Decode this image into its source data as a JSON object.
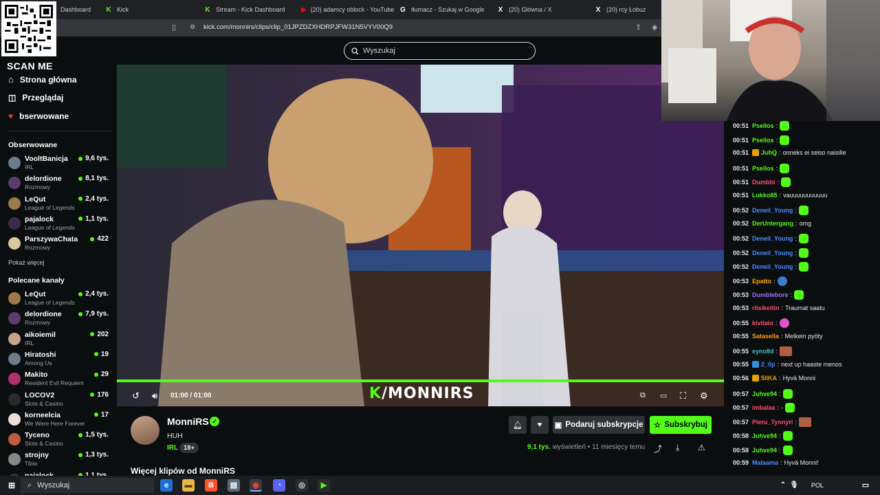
{
  "browser": {
    "tabs": [
      {
        "label": "Dashboard",
        "icon": "kick-icon",
        "color": "#53fc18"
      },
      {
        "label": "Kick",
        "icon": "kick-icon",
        "color": "#53fc18"
      },
      {
        "label": "Stream - Kick Dashboard",
        "icon": "kick-icon",
        "color": "#53fc18"
      },
      {
        "label": "(20) adamcy oblock - YouTube",
        "icon": "youtube-icon",
        "color": "#ff0000"
      },
      {
        "label": "tłumacz - Szukaj w Google",
        "icon": "google-icon",
        "color": "#ffffff"
      },
      {
        "label": "(20) Główna / X",
        "icon": "x-icon",
        "color": "#ffffff"
      },
      {
        "label": "(20) rcy Łobuz",
        "icon": "x-icon",
        "color": "#ffffff"
      }
    ],
    "url": "kick.com/monnirs/clips/clip_01JPZDZXHDRPJFW31N5VYV00Q9"
  },
  "overlay": {
    "scan_me": "SCAN ME"
  },
  "search": {
    "placeholder": "Wyszukaj"
  },
  "sidebar": {
    "nav": [
      {
        "label": "Strona główna",
        "icon": "home-icon"
      },
      {
        "label": "Przeglądaj",
        "icon": "browse-icon"
      },
      {
        "label": "bserwowane",
        "icon": "heart-icon"
      }
    ],
    "following_title": "Obserwowane",
    "following": [
      {
        "name": "VooltBanicja",
        "category": "IRL",
        "viewers": "9,6 tys.",
        "avatar": "#6a7d8c"
      },
      {
        "name": "delordione",
        "category": "Rozmowy",
        "viewers": "8,1 tys.",
        "avatar": "#5a3d6e"
      },
      {
        "name": "LeQut",
        "category": "League of Legends",
        "viewers": "2,4 tys.",
        "avatar": "#9c7a4a"
      },
      {
        "name": "pajalock",
        "category": "League of Legends",
        "viewers": "1,1 tys.",
        "avatar": "#3d2a4a"
      },
      {
        "name": "ParszywaChata",
        "category": "Rozmowy",
        "viewers": "422",
        "avatar": "#d9c8a0"
      }
    ],
    "show_more": "Pokaż więcej",
    "recommended_title": "Polecane kanały",
    "recommended": [
      {
        "name": "LeQut",
        "category": "League of Legends",
        "viewers": "2,4 tys.",
        "avatar": "#9c7a4a"
      },
      {
        "name": "delordione",
        "category": "Rozmowy",
        "viewers": "7,9 tys.",
        "avatar": "#5a3d6e"
      },
      {
        "name": "aikoiemil",
        "category": "IRL",
        "viewers": "202",
        "avatar": "#c4a58a"
      },
      {
        "name": "Hiratoshi",
        "category": "Among Us",
        "viewers": "19",
        "avatar": "#707a88"
      },
      {
        "name": "Makito",
        "category": "Resident Evil Requiem",
        "viewers": "29",
        "avatar": "#b0306a"
      },
      {
        "name": "LOCOV2",
        "category": "Slots & Casino",
        "viewers": "176",
        "avatar": "#2a2a2a"
      },
      {
        "name": "korneelcia",
        "category": "We Were Here Forever",
        "viewers": "17",
        "avatar": "#e8e0d8"
      },
      {
        "name": "Tyceno",
        "category": "Slots & Casino",
        "viewers": "1,5 tys.",
        "avatar": "#c05a40"
      },
      {
        "name": "strojny",
        "category": "Tibia",
        "viewers": "1,3 tys.",
        "avatar": "#888888"
      },
      {
        "name": "pajalock",
        "category": "",
        "viewers": "1,1 tys.",
        "avatar": "#3d2a4a"
      }
    ]
  },
  "player": {
    "time": "01:00 / 01:00",
    "progress": 1.0,
    "watermark_k": "K",
    "watermark_text": "/MONNIRS"
  },
  "clip": {
    "channel": "MonniRS",
    "title": "HUH",
    "tag": "IRL",
    "age_badge": "18+",
    "gift_label": "Podaruj subskrypcje",
    "subscribe_label": "Subskrybuj",
    "views": "9,1 tys.",
    "views_suffix": "wyświetleń",
    "separator": "•",
    "ago": "11 miesięcy temu",
    "more_clips": "Więcej klipów od MonniRS"
  },
  "chat": [
    {
      "time": "00:51",
      "user": "Psellos",
      "color": "#53fc18",
      "text": "",
      "emote": "green"
    },
    {
      "time": "00:51",
      "user": "Psellos",
      "color": "#53fc18",
      "text": "",
      "emote": "green"
    },
    {
      "time": "00:51",
      "user": "JuhQ",
      "color": "#53fc18",
      "text": "onneks ei seiso naisille",
      "emote": "",
      "badge": "gold"
    },
    {
      "time": "00:51",
      "user": "Psellos",
      "color": "#53fc18",
      "text": "",
      "emote": "green"
    },
    {
      "time": "00:51",
      "user": "Dumbbi",
      "color": "#ff4d6d",
      "text": "",
      "emote": "green"
    },
    {
      "time": "00:51",
      "user": "Lukko85",
      "color": "#53fc18",
      "text": "vauuuuuuuuuuu",
      "emote": ""
    },
    {
      "time": "00:52",
      "user": "Deneil_Young",
      "color": "#4a8cff",
      "text": "",
      "emote": "green"
    },
    {
      "time": "00:52",
      "user": "DerUntergang",
      "color": "#53fc18",
      "text": "omg",
      "emote": ""
    },
    {
      "time": "00:52",
      "user": "Deneil_Young",
      "color": "#4a8cff",
      "text": "",
      "emote": "green"
    },
    {
      "time": "00:52",
      "user": "Deneil_Young",
      "color": "#4a8cff",
      "text": "",
      "emote": "green"
    },
    {
      "time": "00:52",
      "user": "Deneil_Young",
      "color": "#4a8cff",
      "text": "",
      "emote": "green"
    },
    {
      "time": "00:53",
      "user": "Epatto",
      "color": "#ffa500",
      "text": "",
      "emote": "blue"
    },
    {
      "time": "00:53",
      "user": "Dumblebore",
      "color": "#a070ff",
      "text": "",
      "emote": "green"
    },
    {
      "time": "00:53",
      "user": "riisikeitin",
      "color": "#ff4d6d",
      "text": "Traumat saatu",
      "emote": ""
    },
    {
      "time": "00:55",
      "user": "kivitalo",
      "color": "#ff4d6d",
      "text": "",
      "emote": "pink"
    },
    {
      "time": "00:55",
      "user": "Satasella",
      "color": "#ffa500",
      "text": "Melkein pyöty",
      "emote": ""
    },
    {
      "time": "00:55",
      "user": "eyno8d",
      "color": "#4ac0c0",
      "text": "",
      "emote": "img"
    },
    {
      "time": "00:55",
      "user": "2_0p",
      "color": "#4a8cff",
      "text": "next up haaste menos",
      "emote": "",
      "badge": "blue"
    },
    {
      "time": "00:56",
      "user": "5IIKA",
      "color": "#e8a000",
      "text": "Hyvä Monni",
      "emote": "",
      "badge": "gold"
    },
    {
      "time": "00:57",
      "user": "Juhve94",
      "color": "#53fc18",
      "text": "",
      "emote": "green"
    },
    {
      "time": "00:57",
      "user": "imbalaa",
      "color": "#ff4d6d",
      "text": "-",
      "emote": "green"
    },
    {
      "time": "00:57",
      "user": "Pieru_Tynnyri",
      "color": "#ff4d6d",
      "text": "",
      "emote": "img"
    },
    {
      "time": "00:58",
      "user": "Juhve94",
      "color": "#53fc18",
      "text": "",
      "emote": "green"
    },
    {
      "time": "00:58",
      "user": "Juhve94",
      "color": "#53fc18",
      "text": "",
      "emote": "green"
    },
    {
      "time": "00:59",
      "user": "Malaama",
      "color": "#4a8cff",
      "text": "Hyvä Monni!",
      "emote": ""
    }
  ],
  "taskbar": {
    "search_label": "Wyszukaj",
    "lang": "POL"
  }
}
